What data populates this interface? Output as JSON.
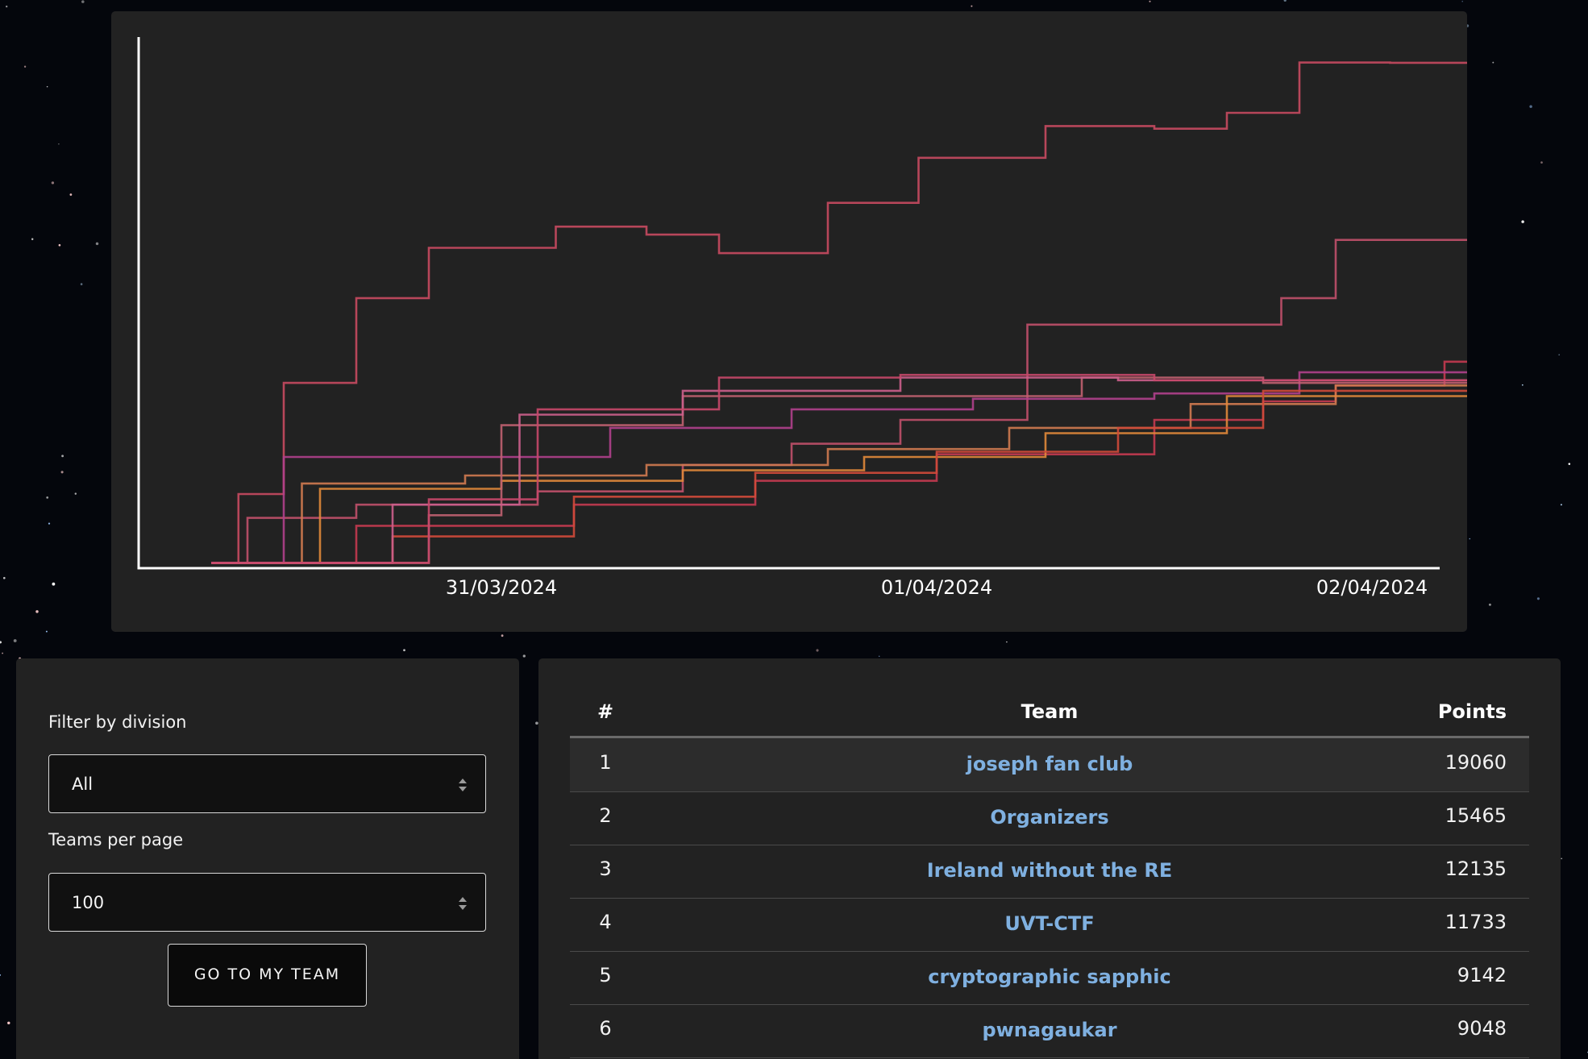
{
  "colors": {
    "background": "#04060c",
    "panel": "#222222",
    "link": "#7fb0e0",
    "text": "#ffffff",
    "axis": "#ffffff"
  },
  "chart_data": {
    "type": "line",
    "title": "",
    "xlabel": "",
    "ylabel": "",
    "x_tick_labels": [
      "31/03/2024",
      "01/04/2024",
      "02/04/2024"
    ],
    "grid": false,
    "legend": "none",
    "series": [
      {
        "color": "#c84a60",
        "x": [
          "2024-03-30 08:00",
          "2024-03-30 09:30",
          "2024-03-30 12:00",
          "2024-03-30 16:00",
          "2024-03-30 20:00",
          "2024-03-31 03:00",
          "2024-03-31 08:00",
          "2024-03-31 12:00",
          "2024-03-31 18:00",
          "2024-03-31 23:00",
          "2024-04-01 06:00",
          "2024-04-01 12:00",
          "2024-04-01 16:00",
          "2024-04-01 20:00",
          "2024-04-02 01:00",
          "2024-04-02 06:00"
        ],
        "y": [
          200,
          2800,
          7000,
          10200,
          12100,
          12900,
          12600,
          11900,
          13800,
          15500,
          16700,
          16600,
          17200,
          19100,
          19090,
          19060
        ]
      },
      {
        "color": "#c0506a",
        "x": [
          "2024-03-30 08:00",
          "2024-03-30 10:00",
          "2024-03-30 16:00",
          "2024-03-31 02:00",
          "2024-03-31 10:00",
          "2024-03-31 16:00",
          "2024-03-31 22:00",
          "2024-04-01 05:00",
          "2024-04-01 14:00",
          "2024-04-01 19:00",
          "2024-04-01 22:00",
          "2024-04-02 06:00"
        ],
        "y": [
          200,
          1900,
          2400,
          2900,
          3900,
          4700,
          5600,
          9200,
          9200,
          10200,
          12400,
          15465
        ]
      },
      {
        "color": "#c43a50",
        "x": [
          "2024-03-30 08:00",
          "2024-03-30 16:00",
          "2024-03-31 04:00",
          "2024-03-31 14:00",
          "2024-04-01 00:00",
          "2024-04-01 12:00",
          "2024-04-01 18:00",
          "2024-04-01 22:00",
          "2024-04-02 04:00",
          "2024-04-02 05:30",
          "2024-04-02 06:00"
        ],
        "y": [
          200,
          1600,
          2400,
          3300,
          4300,
          5600,
          6300,
          6900,
          7800,
          8400,
          12135
        ]
      },
      {
        "color": "#b0408c",
        "x": [
          "2024-03-30 08:00",
          "2024-03-30 12:00",
          "2024-03-30 20:00",
          "2024-03-31 06:00",
          "2024-03-31 16:00",
          "2024-04-01 02:00",
          "2024-04-01 12:00",
          "2024-04-01 20:00",
          "2024-04-02 06:00"
        ],
        "y": [
          200,
          4200,
          4200,
          5300,
          6000,
          6400,
          6600,
          7400,
          7800
        ]
      },
      {
        "color": "#d07a50",
        "x": [
          "2024-03-30 08:00",
          "2024-03-30 13:00",
          "2024-03-30 22:00",
          "2024-03-31 08:00",
          "2024-03-31 18:00",
          "2024-04-01 04:00",
          "2024-04-01 14:00",
          "2024-04-01 22:00",
          "2024-04-02 06:00"
        ],
        "y": [
          200,
          3200,
          3500,
          3900,
          4500,
          5300,
          6200,
          6900,
          7300
        ]
      },
      {
        "color": "#e0883a",
        "x": [
          "2024-03-30 08:00",
          "2024-03-30 14:00",
          "2024-03-31 00:00",
          "2024-03-31 10:00",
          "2024-03-31 20:00",
          "2024-04-01 06:00",
          "2024-04-01 16:00",
          "2024-04-02 06:00"
        ],
        "y": [
          200,
          3000,
          3300,
          3700,
          4200,
          5100,
          6500,
          6800
        ]
      },
      {
        "color": "#d04a3a",
        "x": [
          "2024-03-30 08:00",
          "2024-03-30 18:00",
          "2024-03-31 04:00",
          "2024-03-31 14:00",
          "2024-04-01 00:00",
          "2024-04-01 10:00",
          "2024-04-01 18:00",
          "2024-04-02 06:00"
        ],
        "y": [
          200,
          1200,
          2700,
          3600,
          4400,
          5300,
          6700,
          7100
        ]
      },
      {
        "color": "#c06070",
        "x": [
          "2024-03-30 08:00",
          "2024-03-30 20:00",
          "2024-03-31 00:00",
          "2024-03-31 10:00",
          "2024-03-31 20:00",
          "2024-04-01 08:00",
          "2024-04-01 18:00",
          "2024-04-02 06:00"
        ],
        "y": [
          200,
          2000,
          5400,
          6500,
          6500,
          7200,
          7000,
          7300
        ]
      },
      {
        "color": "#cc5f8c",
        "x": [
          "2024-03-30 08:00",
          "2024-03-30 18:00",
          "2024-03-31 01:00",
          "2024-03-31 10:00",
          "2024-03-31 22:00",
          "2024-04-01 10:00",
          "2024-04-02 06:00"
        ],
        "y": [
          200,
          2400,
          5800,
          6700,
          7200,
          7100,
          7000
        ]
      },
      {
        "color": "#c8486a",
        "x": [
          "2024-03-30 08:00",
          "2024-03-30 20:00",
          "2024-03-31 02:00",
          "2024-03-31 12:00",
          "2024-03-31 22:00",
          "2024-04-01 12:00",
          "2024-04-02 06:00"
        ],
        "y": [
          200,
          2600,
          6000,
          7200,
          7300,
          7100,
          7100
        ]
      }
    ]
  },
  "filters": {
    "division_label": "Filter by division",
    "division_value": "All",
    "per_page_label": "Teams per page",
    "per_page_value": "100",
    "goto_label": "GO TO MY TEAM"
  },
  "table": {
    "headers": {
      "rank": "#",
      "team": "Team",
      "points": "Points"
    },
    "rows": [
      {
        "rank": "1",
        "team": "joseph fan club",
        "points": "19060"
      },
      {
        "rank": "2",
        "team": "Organizers",
        "points": "15465"
      },
      {
        "rank": "3",
        "team": "Ireland without the RE",
        "points": "12135"
      },
      {
        "rank": "4",
        "team": "UVT-CTF",
        "points": "11733"
      },
      {
        "rank": "5",
        "team": "cryptographic sapphic",
        "points": "9142"
      },
      {
        "rank": "6",
        "team": "pwnagaukar",
        "points": "9048"
      }
    ]
  }
}
